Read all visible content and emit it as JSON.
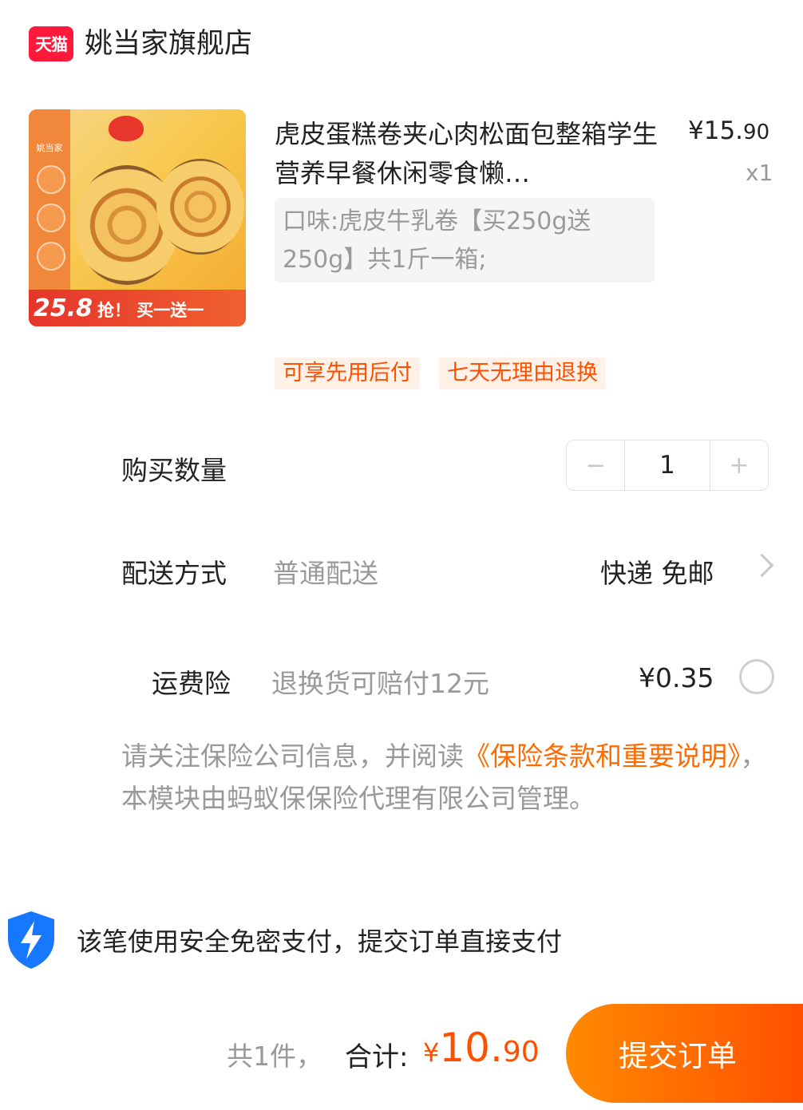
{
  "store": {
    "logo_text": "天猫",
    "name": "姚当家旗舰店"
  },
  "product": {
    "image": {
      "brand": "姚当家",
      "promo_price": "25.8",
      "promo_text": "抢！ 买一送一"
    },
    "title": "虎皮蛋糕卷夹心肉松面包整箱学生营养早餐休闲零食懒…",
    "price_symbol": "¥",
    "price_int": "15.",
    "price_dec": "90",
    "quantity_label": "x1",
    "sku": "口味:虎皮牛乳卷【买250g送250g】共1斤一箱;",
    "tags": [
      "可享先用后付",
      "七天无理由退换"
    ]
  },
  "quantity_row": {
    "label": "购买数量",
    "minus": "−",
    "value": "1",
    "plus": "+"
  },
  "delivery_row": {
    "label": "配送方式",
    "sub": "普通配送",
    "value": "快递 免邮"
  },
  "insurance_row": {
    "label": "运费险",
    "sub": "退换货可赔付12元",
    "price": "¥0.35"
  },
  "notice": {
    "prefix": "请关注保险公司信息，并阅读",
    "link": "《保险条款和重要说明》",
    "suffix": "，本模块由蚂蚁保保险代理有限公司管理。"
  },
  "payment": {
    "text": "该笔使用安全免密支付，提交订单直接支付"
  },
  "footer": {
    "count": "共1件，",
    "total_label": "合计:",
    "total_symbol": "¥",
    "total_int": "10.",
    "total_dec": "90",
    "submit_label": "提交订单"
  },
  "colors": {
    "accent": "#ff5000",
    "tmall_red": "#ff1a3c",
    "shield_blue": "#1677ff"
  }
}
